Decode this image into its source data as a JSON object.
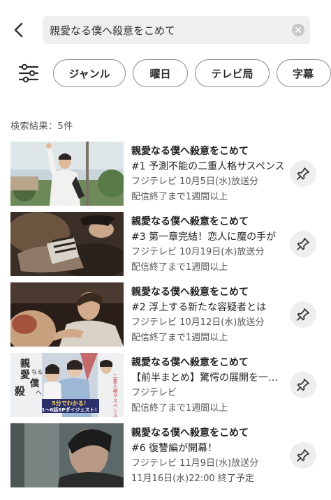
{
  "search": {
    "query": "親愛なる僕へ殺意をこめて"
  },
  "filters": [
    {
      "label": "ジャンル"
    },
    {
      "label": "曜日"
    },
    {
      "label": "テレビ局"
    },
    {
      "label": "字幕"
    }
  ],
  "result_count": "検索結果：5件",
  "results": [
    {
      "title": "親愛なる僕へ殺意をこめて",
      "subtitle": "#1 予測不能の二重人格サスペンス",
      "broadcast": "フジテレビ 10月5日(水)放送分",
      "availability": "配信終了まで1週間以上"
    },
    {
      "title": "親愛なる僕へ殺意をこめて",
      "subtitle": "#3 第一章完結！恋人に魔の手が",
      "broadcast": "フジテレビ 10月19日(水)放送分",
      "availability": "配信終了まで1週間以上"
    },
    {
      "title": "親愛なる僕へ殺意をこめて",
      "subtitle": "#2 浮上する新たな容疑者とは",
      "broadcast": "フジテレビ 10月12日(水)放送分",
      "availability": "配信終了まで1週間以上"
    },
    {
      "title": "親愛なる僕へ殺意をこめて",
      "subtitle": "【前半まとめ】驚愕の展開を一気見",
      "broadcast": "フジテレビ",
      "availability": "配信終了まで1週間以上",
      "thumb_text": {
        "vertical_1": "二重人格サスペンス！",
        "logo_1": "親",
        "logo_2": "愛",
        "logo_3": "なる",
        "logo_4": "僕",
        "logo_5": "へ",
        "logo_6": "殺",
        "banner_1": "5分でわかる！",
        "banner_2": "1～6話SPダイジェスト！"
      }
    },
    {
      "title": "親愛なる僕へ殺意をこめて",
      "subtitle": "#6 復讐編が開幕！",
      "broadcast": "フジテレビ 11月9日(水)放送分",
      "availability": "11月16日(水)22:00 終了予定"
    }
  ]
}
